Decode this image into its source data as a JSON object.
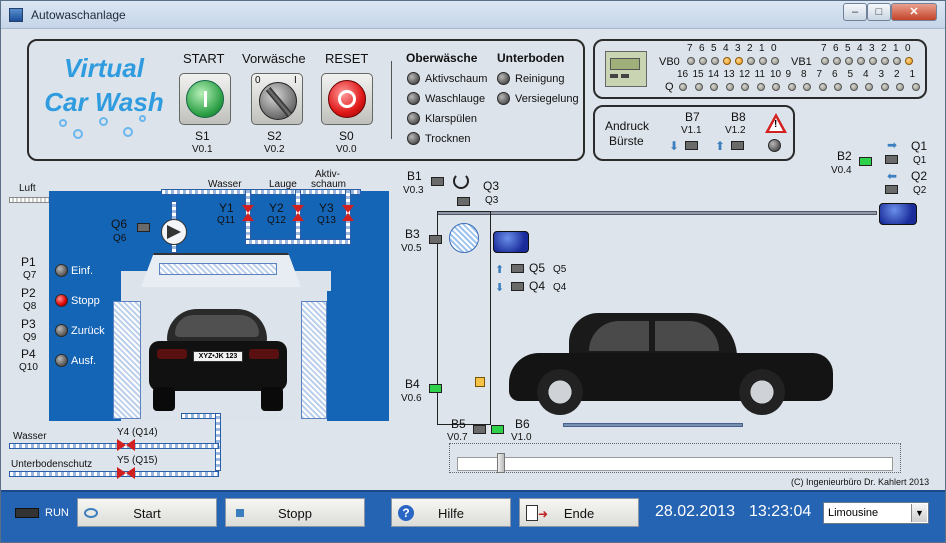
{
  "window": {
    "title": "Autowaschanlage"
  },
  "logo": {
    "line1": "Virtual",
    "line2": "Car Wash"
  },
  "controls": {
    "start": {
      "label": "START",
      "id": "S1",
      "addr": "V0.1"
    },
    "prewash": {
      "label": "Vorwäsche",
      "id": "S2",
      "addr": "V0.2",
      "pos0": "0",
      "pos1": "I"
    },
    "reset": {
      "label": "RESET",
      "id": "S0",
      "addr": "V0.0"
    }
  },
  "oberwaesche": {
    "title": "Oberwäsche",
    "items": [
      "Aktivschaum",
      "Waschlauge",
      "Klarspülen",
      "Trocknen"
    ]
  },
  "unterboden": {
    "title": "Unterboden",
    "items": [
      "Reinigung",
      "Versiegelung"
    ]
  },
  "plc": {
    "vb0": "VB0",
    "vb1": "VB1",
    "q": "Q",
    "bits": [
      "7",
      "6",
      "5",
      "4",
      "3",
      "2",
      "1",
      "0"
    ],
    "qbits": [
      "16",
      "15",
      "14",
      "13",
      "12",
      "11",
      "10",
      "9",
      "8",
      "7",
      "6",
      "5",
      "4",
      "3",
      "2",
      "1"
    ]
  },
  "andruck": {
    "title1": "Andruck",
    "title2": "Bürste",
    "b7": "B7",
    "b7addr": "V1.1",
    "b8": "B8",
    "b8addr": "V1.2"
  },
  "plant": {
    "luft": "Luft",
    "wasser_top": "Wasser",
    "lauge": "Lauge",
    "aktiv1": "Aktiv-",
    "aktiv2": "schaum",
    "y1": "Y1",
    "y1q": "Q11",
    "y2": "Y2",
    "y2q": "Q12",
    "y3": "Y3",
    "y3q": "Q13",
    "q6": "Q6",
    "q6b": "Q6",
    "p1": "P1",
    "p1q": "Q7",
    "p2": "P2",
    "p2q": "Q8",
    "p3": "P3",
    "p3q": "Q9",
    "p4": "P4",
    "p4q": "Q10",
    "ops": [
      "Einf.",
      "Stopp",
      "Zurück",
      "Ausf."
    ],
    "plate": "XYZ•JK 123",
    "wasser": "Wasser",
    "unterbodenschutz": "Unterbodenschutz",
    "y4": "Y4 (Q14)",
    "y5": "Y5 (Q15)"
  },
  "sensors": {
    "b1": "B1",
    "b1addr": "V0.3",
    "q3": "Q3",
    "q3b": "Q3",
    "b2": "B2",
    "b2addr": "V0.4",
    "q1": "Q1",
    "q1b": "Q1",
    "q2": "Q2",
    "q2b": "Q2",
    "b3": "B3",
    "b3addr": "V0.5",
    "q5": "Q5",
    "q5b": "Q5",
    "q4": "Q4",
    "q4b": "Q4",
    "b4": "B4",
    "b4addr": "V0.6",
    "b5": "B5",
    "b5addr": "V0.7",
    "b6": "B6",
    "b6addr": "V1.0"
  },
  "copyright": "(C) Ingenieurbüro Dr. Kahlert 2013",
  "bottom": {
    "run": "RUN",
    "start": "Start",
    "stopp": "Stopp",
    "hilfe": "Hilfe",
    "ende": "Ende",
    "date": "28.02.2013",
    "time": "13:23:04",
    "cartype": "Limousine"
  }
}
